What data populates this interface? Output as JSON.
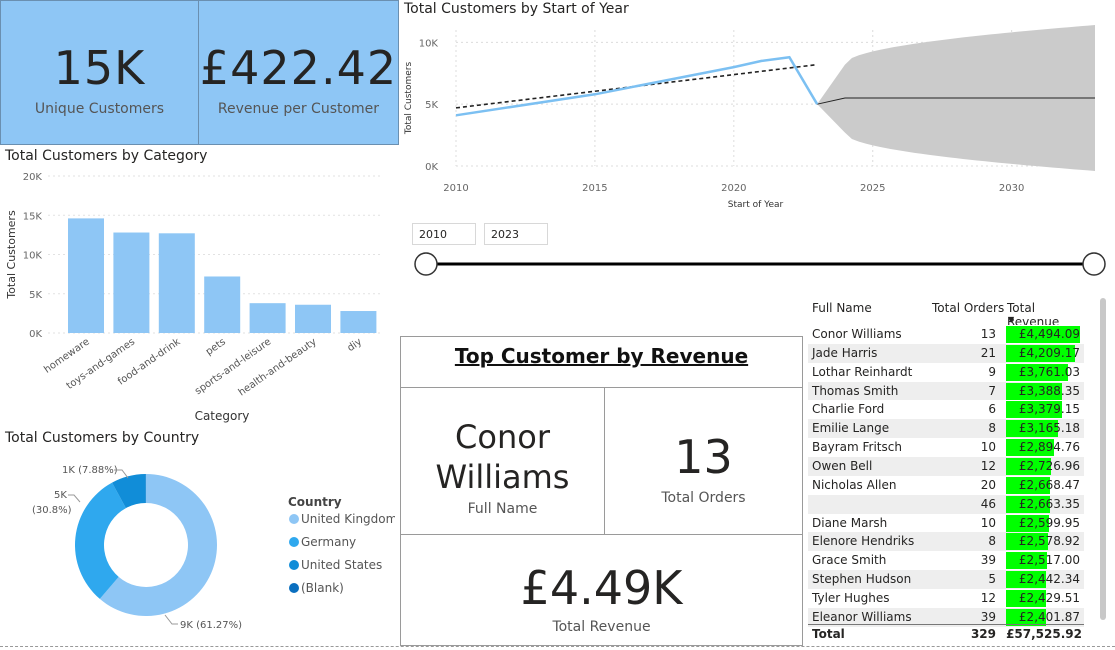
{
  "kpis": {
    "unique_customers": {
      "value": "15K",
      "label": "Unique Customers"
    },
    "revenue_per_customer": {
      "value": "£422.42",
      "label": "Revenue per Customer"
    }
  },
  "line_visual": {
    "title": "Total Customers by Start of Year"
  },
  "category_visual": {
    "title": "Total Customers by Category"
  },
  "country_visual": {
    "title": "Total Customers by Country",
    "legend_title": "Country",
    "legend": [
      "United Kingdom",
      "Germany",
      "United States",
      "(Blank)"
    ],
    "slice_labels": [
      "1K (7.88%)",
      "5K",
      "(30.8%)",
      "9K (61.27%)"
    ]
  },
  "slicer": {
    "start_value": "2010",
    "end_value": "2023"
  },
  "top_customer": {
    "title": "Top Customer by Revenue",
    "full_name_line1": "Conor",
    "full_name_line2": "Williams",
    "full_name_label": "Full Name",
    "total_orders": "13",
    "total_orders_label": "Total Orders",
    "total_revenue": "£4.49K",
    "total_revenue_label": "Total Revenue"
  },
  "table": {
    "headers": [
      "Full Name",
      "Total Orders",
      "Total Revenue"
    ],
    "rows": [
      {
        "name": "Conor Williams",
        "orders": "13",
        "revenue": "£4,494.09",
        "fill": 1.0
      },
      {
        "name": "Jade Harris",
        "orders": "21",
        "revenue": "£4,209.17",
        "fill": 0.937
      },
      {
        "name": "Lothar Reinhardt",
        "orders": "9",
        "revenue": "£3,761.03",
        "fill": 0.837
      },
      {
        "name": "Thomas Smith",
        "orders": "7",
        "revenue": "£3,388.35",
        "fill": 0.754
      },
      {
        "name": "Charlie Ford",
        "orders": "6",
        "revenue": "£3,379.15",
        "fill": 0.752
      },
      {
        "name": "Emilie Lange",
        "orders": "8",
        "revenue": "£3,165.18",
        "fill": 0.704
      },
      {
        "name": "Bayram Fritsch",
        "orders": "10",
        "revenue": "£2,894.76",
        "fill": 0.644
      },
      {
        "name": "Owen Bell",
        "orders": "12",
        "revenue": "£2,726.96",
        "fill": 0.607
      },
      {
        "name": "Nicholas Allen",
        "orders": "20",
        "revenue": "£2,668.47",
        "fill": 0.594
      },
      {
        "name": "",
        "orders": "46",
        "revenue": "£2,663.35",
        "fill": 0.593
      },
      {
        "name": "Diane Marsh",
        "orders": "10",
        "revenue": "£2,599.95",
        "fill": 0.579
      },
      {
        "name": "Elenore Hendriks",
        "orders": "8",
        "revenue": "£2,578.92",
        "fill": 0.574
      },
      {
        "name": "Grace Smith",
        "orders": "39",
        "revenue": "£2,517.00",
        "fill": 0.56
      },
      {
        "name": "Stephen Hudson",
        "orders": "5",
        "revenue": "£2,442.34",
        "fill": 0.543
      },
      {
        "name": "Tyler Hughes",
        "orders": "12",
        "revenue": "£2,429.51",
        "fill": 0.541
      },
      {
        "name": "Eleanor Williams",
        "orders": "39",
        "revenue": "£2,401.87",
        "fill": 0.534
      }
    ],
    "total": {
      "label": "Total",
      "orders": "329",
      "revenue": "£57,525.92"
    }
  },
  "chart_data": [
    {
      "type": "line",
      "title": "Total Customers by Start of Year",
      "xlabel": "Start of Year",
      "ylabel": "Total Customers",
      "xlim": [
        2010,
        2033
      ],
      "ylim": [
        0,
        11000
      ],
      "x_ticks": [
        "2010",
        "2015",
        "2020",
        "2025",
        "2030"
      ],
      "y_ticks": [
        "0K",
        "5K",
        "10K"
      ],
      "series": [
        {
          "x": [
            2010,
            2015,
            2020,
            2021,
            2022,
            2023
          ],
          "values": [
            4100,
            5800,
            8000,
            8500,
            8800,
            5000
          ]
        }
      ],
      "trend_line": {
        "x": [
          2010,
          2023
        ],
        "values": [
          4700,
          8200
        ]
      },
      "forecast": {
        "x": [
          2023,
          2024,
          2033
        ],
        "values": [
          5000,
          5500,
          5500
        ],
        "upper": [
          5000,
          8200,
          11400
        ],
        "lower": [
          5000,
          2700,
          -400
        ]
      },
      "colors": {
        "line": "#7cc0f2",
        "forecast_band": "#cbcbcb",
        "trend": "#222222"
      },
      "grid": true
    },
    {
      "type": "bar",
      "title": "Total Customers by Category",
      "xlabel": "Category",
      "ylabel": "Total Customers",
      "categories": [
        "homeware",
        "toys-and-games",
        "food-and-drink",
        "pets",
        "sports-and-leisure",
        "health-and-beauty",
        "diy"
      ],
      "values": [
        14600,
        12800,
        12700,
        7200,
        3800,
        3600,
        2800
      ],
      "ylim": [
        0,
        20000
      ],
      "y_ticks": [
        "0K",
        "5K",
        "10K",
        "15K",
        "20K"
      ],
      "color": "#8ec6f5",
      "grid": true
    },
    {
      "type": "pie",
      "title": "Total Customers by Country",
      "categories": [
        "United Kingdom",
        "Germany",
        "United States",
        "(Blank)"
      ],
      "values": [
        61.27,
        30.8,
        7.88,
        0.05
      ],
      "colors": [
        "#8ec6f5",
        "#2fa8ee",
        "#118dd8",
        "#0a6fbf"
      ],
      "legend_position": "right"
    }
  ]
}
